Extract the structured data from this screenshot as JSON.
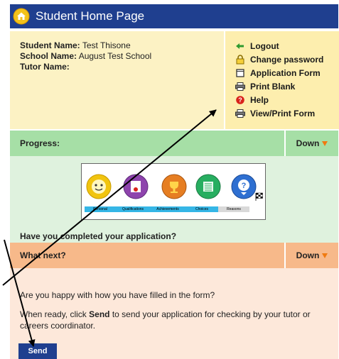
{
  "header": {
    "title": "Student Home Page",
    "icon": "home-icon"
  },
  "student": {
    "name_label": "Student Name:",
    "name_value": "Test Thisone",
    "school_label": "School Name:",
    "school_value": "August Test School",
    "tutor_label": "Tutor Name:",
    "tutor_value": ""
  },
  "links": [
    {
      "label": "Logout",
      "icon": "arrow-left-icon"
    },
    {
      "label": "Change password",
      "icon": "lock-icon"
    },
    {
      "label": "Application Form",
      "icon": "form-icon"
    },
    {
      "label": "Print Blank",
      "icon": "printer-icon"
    },
    {
      "label": "Help",
      "icon": "help-icon"
    },
    {
      "label": "View/Print Form",
      "icon": "printer-icon"
    }
  ],
  "progress": {
    "label": "Progress:",
    "toggle": "Down",
    "steps": [
      "Personal",
      "Qualifications",
      "Achievements",
      "Choices",
      "Reasons"
    ],
    "question": "Have you completed your application?"
  },
  "next": {
    "label": "What next?",
    "toggle": "Down",
    "question": "Are you happy with how you have filled in the form?",
    "instruction_pre": "When ready, click ",
    "instruction_bold": "Send",
    "instruction_post": " to send your application for checking by your tutor or careers coordinator.",
    "send_button": "Send"
  },
  "colors": {
    "title_bar": "#1f3f8f",
    "info_bg": "#fcf2c4",
    "progress_bar": "#a6dfa6",
    "next_bar": "#f7b98a",
    "toggle_arrow": "#f07a10"
  }
}
